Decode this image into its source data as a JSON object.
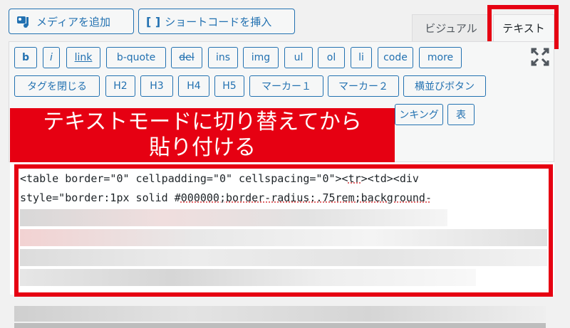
{
  "toolbar_top": {
    "add_media": "メディアを追加",
    "insert_shortcode": "ショートコードを挿入"
  },
  "tabs": {
    "visual": "ビジュアル",
    "text": "テキスト"
  },
  "quicktags": {
    "row1": [
      "b",
      "i",
      "link",
      "b-quote",
      "del",
      "ins",
      "img",
      "ul",
      "ol",
      "li",
      "code",
      "more"
    ],
    "row2": [
      "タグを閉じる",
      "H2",
      "H3",
      "H4",
      "H5",
      "マーカー１",
      "マーカー２",
      "横並びボタン"
    ],
    "row3_visible": [
      "ンキング",
      "表"
    ]
  },
  "annotation": {
    "line1": "テキストモードに切り替えてから",
    "line2": "貼り付ける"
  },
  "code": {
    "line1a": "<table border=\"0\" cellpadding=\"0\" cellspacing=\"0\"><",
    "line1b": "tr",
    "line1c": "><td><div",
    "line2a": "style=\"border:1px solid #",
    "line2b": "000000;border-radius:.75rem;background-",
    "line2c": ""
  },
  "colors": {
    "accent": "#2271b1",
    "highlight": "#e60012"
  }
}
